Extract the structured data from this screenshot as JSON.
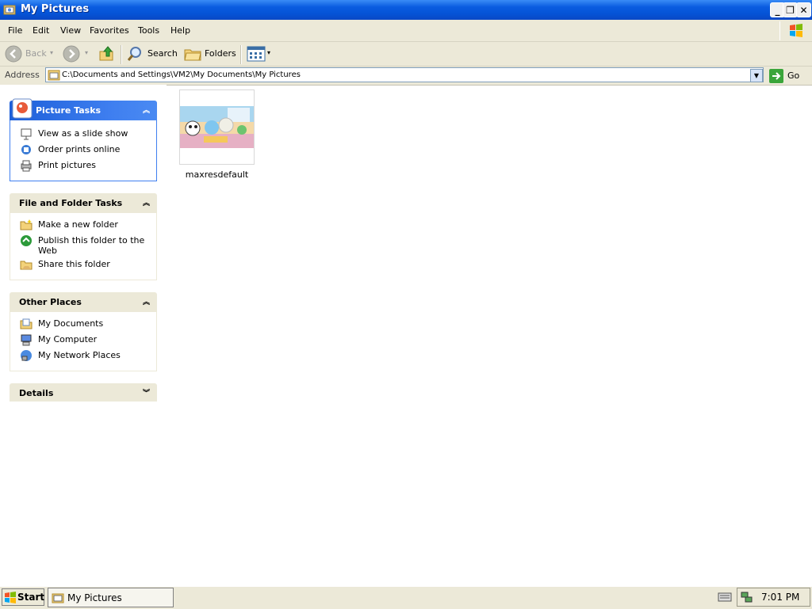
{
  "window": {
    "title": "My Pictures",
    "buttons": {
      "minimize": "_",
      "restore": "❐",
      "close": "✕"
    }
  },
  "menubar": {
    "items": [
      "File",
      "Edit",
      "View",
      "Favorites",
      "Tools",
      "Help"
    ]
  },
  "toolbar": {
    "back_label": "Back",
    "search_label": "Search",
    "folders_label": "Folders"
  },
  "address": {
    "label": "Address",
    "path": "C:\\Documents and Settings\\VM2\\My Documents\\My Pictures",
    "go_label": "Go"
  },
  "tasks": {
    "picture": {
      "title": "Picture Tasks",
      "items": [
        "View as a slide show",
        "Order prints online",
        "Print pictures"
      ]
    },
    "file_folder": {
      "title": "File and Folder Tasks",
      "items": [
        "Make a new folder",
        "Publish this folder to the Web",
        "Share this folder"
      ]
    },
    "other_places": {
      "title": "Other Places",
      "items": [
        "My Documents",
        "My Computer",
        "My Network Places"
      ]
    },
    "details": {
      "title": "Details"
    }
  },
  "files": [
    {
      "name": "maxresdefault"
    }
  ],
  "taskbar": {
    "start_label": "Start",
    "window_button": "My Pictures",
    "clock": "7:01 PM"
  },
  "colors": {
    "titlebar": "#0a5ce0",
    "panel_blue": "#3f7ff0",
    "chrome": "#ece9d8"
  }
}
